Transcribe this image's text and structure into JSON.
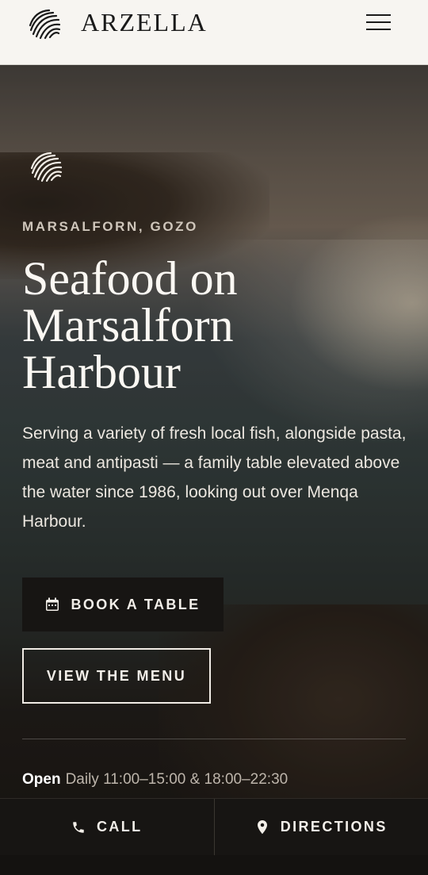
{
  "header": {
    "brand": "ARZELLA",
    "logo_icon": "shell-logo-icon",
    "menu_icon": "hamburger-menu-icon"
  },
  "hero": {
    "emblem_icon": "shell-logo-icon",
    "eyebrow": "MARSALFORN, GOZO",
    "headline_lines": [
      "Seafood on",
      "Marsalforn",
      "Harbour"
    ],
    "lede": "Serving a variety of fresh local fish, alongside pasta, meat and antipasti — a family table elevated above the water since 1986, looking out over Menqa Harbour.",
    "book_button": {
      "icon": "calendar-icon",
      "label": "BOOK A TABLE"
    },
    "menu_button": {
      "label": "VIEW THE MENU"
    },
    "hours": {
      "open_label": "Open",
      "text": "Daily 11:00–15:00 & 18:00–22:30"
    }
  },
  "bottom_bar": {
    "call": {
      "icon": "phone-icon",
      "label": "CALL"
    },
    "directions": {
      "icon": "location-pin-icon",
      "label": "DIRECTIONS"
    }
  },
  "colors": {
    "header_bg": "#f7f5f1",
    "dark": "#171513",
    "text_light": "#f3efe9",
    "eyebrow": "#cfc6bb"
  }
}
